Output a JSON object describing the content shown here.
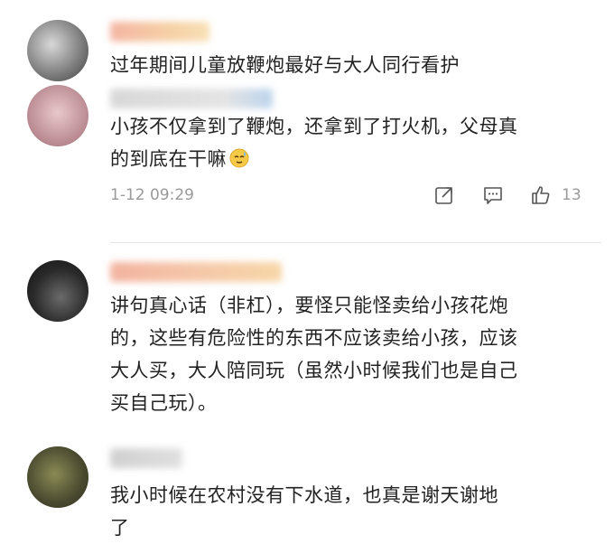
{
  "comments": [
    {
      "text": "过年期间儿童放鞭炮最好与大人同行看护",
      "avatar_color": "#8a8a8a"
    },
    {
      "text": "小孩不仅拿到了鞭炮，还拿到了打火机，父母真\n的到底在干嘛",
      "emoji": "sweat-smile-emoji",
      "timestamp": "1-12 09:29",
      "likes": "13",
      "avatar_color": "#c9a3a8"
    },
    {
      "text": "讲句真心话（非杠），要怪只能怪卖给小孩花炮\n的，这些有危险性的东西不应该卖给小孩，应该\n大人买，大人陪同玩（虽然小时候我们也是自己\n买自己玩）。",
      "avatar_color": "#2a2a2a"
    },
    {
      "text": "我小时候在农村没有下水道，也真是谢天谢地\n了",
      "avatar_color": "#4a4a35"
    }
  ],
  "icons": {
    "share": "share-icon",
    "comment": "comment-icon",
    "like": "thumbs-up-icon"
  }
}
